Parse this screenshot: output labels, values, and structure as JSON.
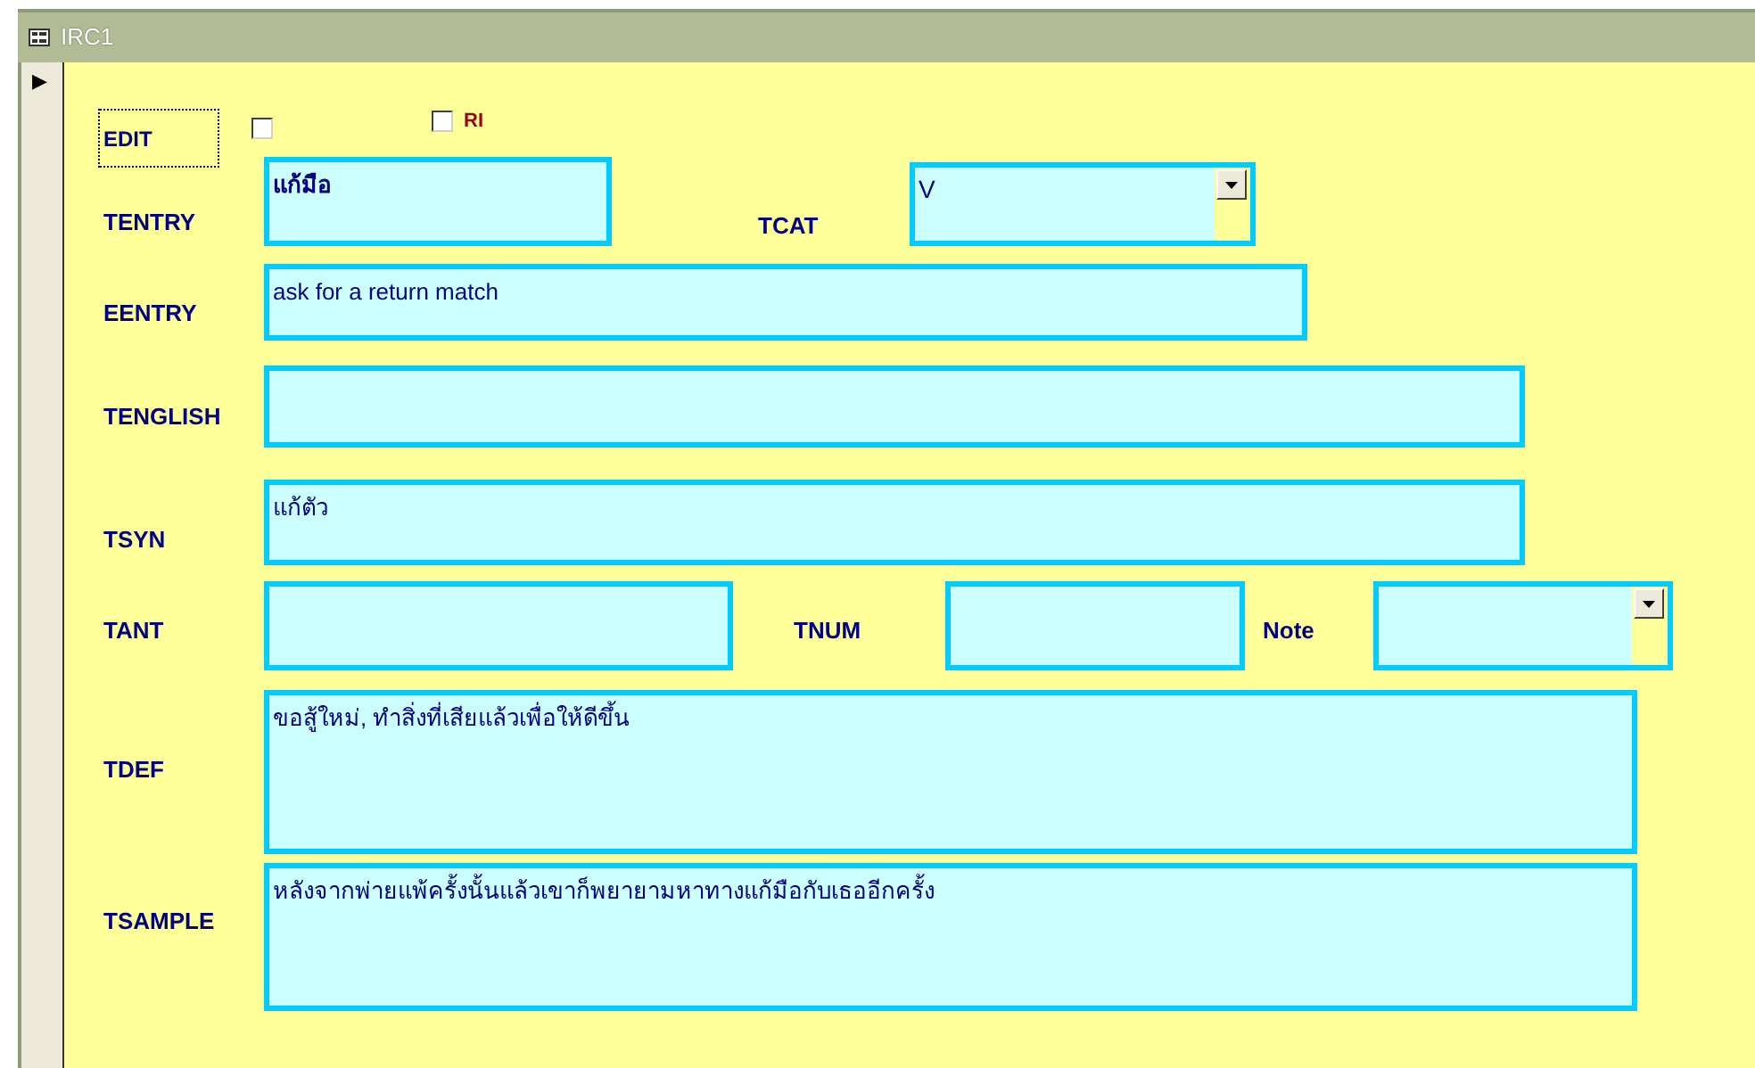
{
  "window": {
    "title": "IRC1"
  },
  "record_selector": {
    "marker": "▶"
  },
  "edit": {
    "label": "EDIT",
    "focused": true,
    "checked": false
  },
  "ri": {
    "label": "RI",
    "checked": false
  },
  "fields": [
    {
      "label": "TENTRY",
      "kind": "headword",
      "value": "แก้มือ"
    },
    {
      "label": "TCAT",
      "kind": "combo",
      "value": "V"
    },
    {
      "label": "EENTRY",
      "kind": "text",
      "value": "ask for a return match"
    },
    {
      "label": "TENGLISH",
      "kind": "text"
    },
    {
      "label": "TSYN",
      "kind": "text",
      "value": "แก้ตัว"
    },
    {
      "label": "TANT",
      "kind": "text"
    },
    {
      "label": "TNUM",
      "kind": "text"
    },
    {
      "label": "Note",
      "kind": "combo"
    },
    {
      "label": "TDEF",
      "kind": "text",
      "value": "ขอสู้ใหม่, ทำสิ่งที่เสียแล้วเพื่อให้ดีขึ้น"
    },
    {
      "label": "TSAMPLE",
      "kind": "text",
      "value": "หลังจากพ่ายแพ้ครั้งนั้นแล้วเขาก็พยายามหาทางแก้มือกับเธออีกครั้ง"
    }
  ]
}
